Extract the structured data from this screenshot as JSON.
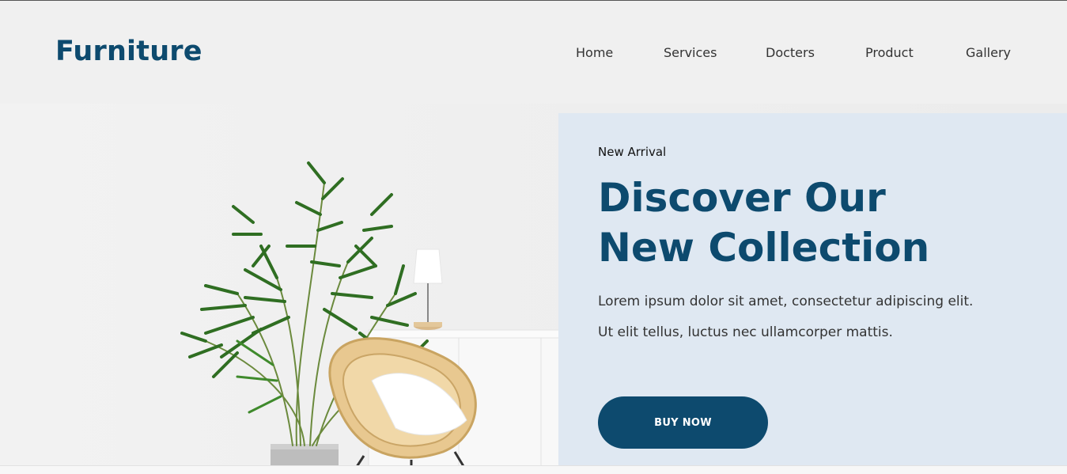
{
  "brand": {
    "logo_text": "Furniture"
  },
  "nav": {
    "items": [
      {
        "label": "Home"
      },
      {
        "label": "Services"
      },
      {
        "label": "Docters"
      },
      {
        "label": "Product"
      },
      {
        "label": "Gallery"
      }
    ]
  },
  "hero": {
    "eyebrow": "New Arrival",
    "headline_line1": "Discover Our",
    "headline_line2": "New Collection",
    "description_line1": "Lorem ipsum dolor sit amet, consectetur adipiscing elit.",
    "description_line2": "Ut elit tellus, luctus nec ullamcorper mattis.",
    "cta_label": "BUY NOW"
  },
  "colors": {
    "brand": "#0d4a6e",
    "panel_bg": "#dfe8f2",
    "page_bg": "#f0f0f0",
    "nav_text": "#333333"
  }
}
